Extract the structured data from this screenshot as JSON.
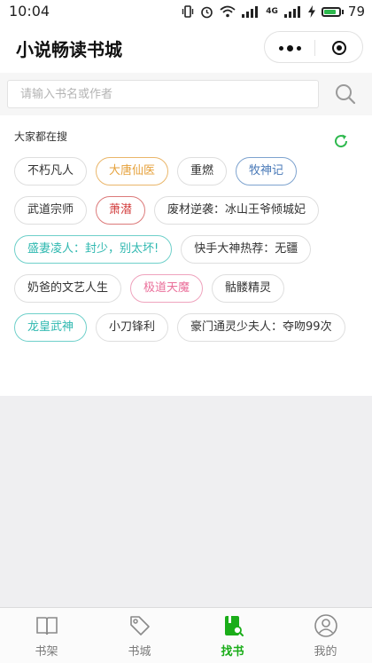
{
  "status_bar": {
    "time": "10:04",
    "network_label": "4G",
    "battery_percent": 79,
    "battery_label": "79"
  },
  "header": {
    "title": "小说畅读书城",
    "menu_icon": "more-dots-icon",
    "close_icon": "circle-dot-icon"
  },
  "search": {
    "placeholder": "请输入书名或作者",
    "value": "",
    "icon": "search-icon"
  },
  "hot": {
    "label": "大家都在搜",
    "refresh_icon": "refresh-icon",
    "tags": [
      {
        "text": "不朽凡人",
        "color": "#333333",
        "border": "#dedede"
      },
      {
        "text": "大唐仙医",
        "color": "#e6a23c",
        "border": "#eab66a"
      },
      {
        "text": "重燃",
        "color": "#333333",
        "border": "#dedede"
      },
      {
        "text": "牧神记",
        "color": "#4a7ab8",
        "border": "#7ea3cf"
      },
      {
        "text": "武道宗师",
        "color": "#333333",
        "border": "#dedede"
      },
      {
        "text": "萧潜",
        "color": "#d23c3c",
        "border": "#dc7a7a"
      },
      {
        "text": "废材逆袭：冰山王爷倾城妃",
        "color": "#333333",
        "border": "#dedede"
      },
      {
        "text": "盛妻凌人：封少，别太坏!",
        "color": "#2fb8b0",
        "border": "#6fd0ca"
      },
      {
        "text": "快手大神热荐：无疆",
        "color": "#333333",
        "border": "#dedede"
      },
      {
        "text": "奶爸的文艺人生",
        "color": "#333333",
        "border": "#dedede"
      },
      {
        "text": "极道天魔",
        "color": "#ea6f9a",
        "border": "#efa3bd"
      },
      {
        "text": "骷髅精灵",
        "color": "#333333",
        "border": "#dedede"
      },
      {
        "text": "龙皇武神",
        "color": "#2fb8b0",
        "border": "#6fd0ca"
      },
      {
        "text": "小刀锋利",
        "color": "#333333",
        "border": "#dedede"
      },
      {
        "text": "豪门通灵少夫人：夺吻99次",
        "color": "#333333",
        "border": "#dedede"
      }
    ]
  },
  "tabbar": {
    "active_color": "#1aad19",
    "items": [
      {
        "label": "书架",
        "icon": "book-open-icon"
      },
      {
        "label": "书城",
        "icon": "tag-icon"
      },
      {
        "label": "找书",
        "icon": "find-book-icon"
      },
      {
        "label": "我的",
        "icon": "user-icon"
      }
    ]
  }
}
